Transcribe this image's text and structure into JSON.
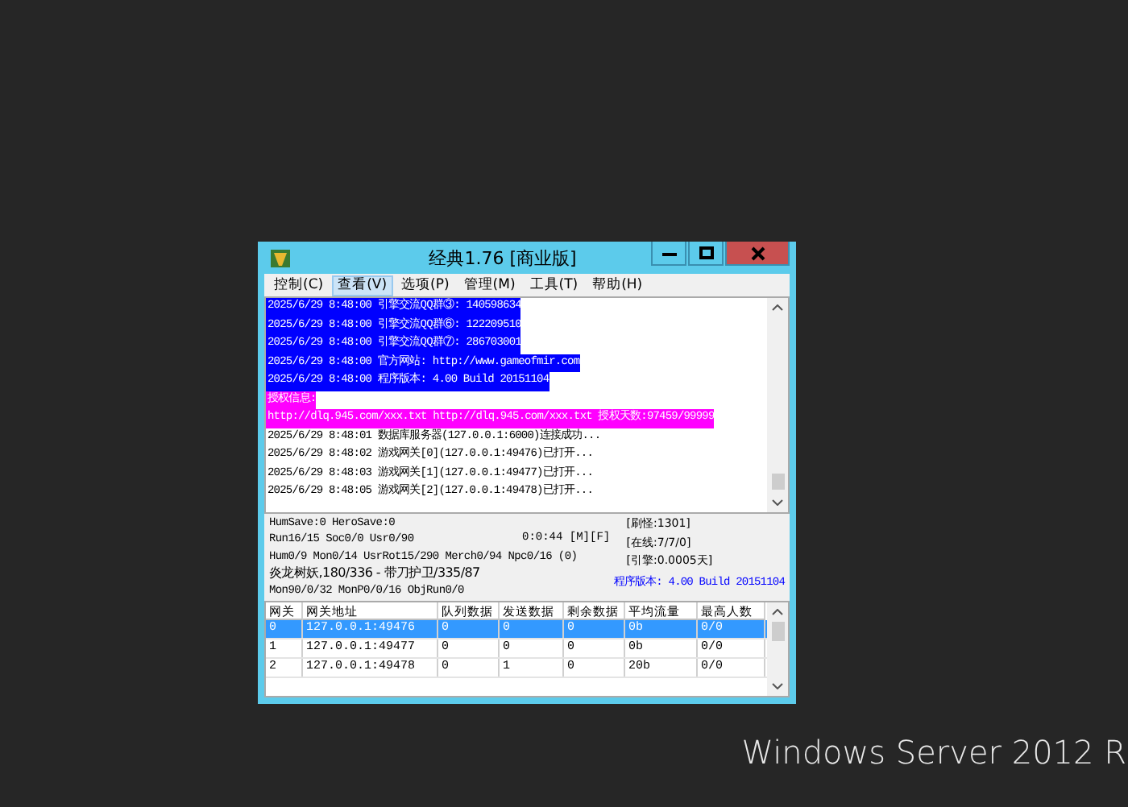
{
  "window": {
    "title": "经典1.76 [商业版]"
  },
  "menu": [
    {
      "label": "控制(C)",
      "selected": false
    },
    {
      "label": "查看(V)",
      "selected": true
    },
    {
      "label": "选项(P)",
      "selected": false
    },
    {
      "label": "管理(M)",
      "selected": false
    },
    {
      "label": "工具(T)",
      "selected": false
    },
    {
      "label": "帮助(H)",
      "selected": false
    }
  ],
  "log": [
    {
      "kind": "selected",
      "text": "2025/6/29 8:48:00 引擎交流QQ群③: 140598634"
    },
    {
      "kind": "selected",
      "text": "2025/6/29 8:48:00 引擎交流QQ群⑥: 122209510"
    },
    {
      "kind": "selected",
      "text": "2025/6/29 8:48:00 引擎交流QQ群⑦: 286703001"
    },
    {
      "kind": "selected",
      "text": "2025/6/29 8:48:00 官方网站: http://www.gameofmir.com"
    },
    {
      "kind": "selected",
      "text": "2025/6/29 8:48:00 程序版本: 4.00 Build 20151104"
    },
    {
      "kind": "highlight",
      "text": "授权信息:"
    },
    {
      "kind": "highlight",
      "text": "http://dlq.945.com/xxx.txt http://dlq.945.com/xxx.txt 授权天数:97459/99999"
    },
    {
      "kind": "normal",
      "text": "2025/6/29 8:48:01 数据库服务器(127.0.0.1:6000)连接成功..."
    },
    {
      "kind": "normal",
      "text": "2025/6/29 8:48:02 游戏网关[0](127.0.0.1:49476)已打开..."
    },
    {
      "kind": "normal",
      "text": "2025/6/29 8:48:03 游戏网关[1](127.0.0.1:49477)已打开..."
    },
    {
      "kind": "normal",
      "text": "2025/6/29 8:48:05 游戏网关[2](127.0.0.1:49478)已打开..."
    }
  ],
  "status": {
    "lines": [
      "HumSave:0 HeroSave:0",
      "Run16/15 Soc0/0 Usr0/90",
      "Hum0/9 Mon0/14 UsrRot15/290 Merch0/94 Npc0/16 (0)",
      "炎龙树妖,180/336 - 带刀护卫/335/87",
      "Mon90/0/32 MonP0/0/16 ObjRun0/0"
    ],
    "timer": "0:0:44 [M][F]",
    "counters": [
      "[刷怪:1301]",
      "[在线:7/7/0]",
      "[引擎:0.0005天]"
    ],
    "version": "程序版本: 4.00 Build 20151104"
  },
  "table": {
    "columns": [
      "网关",
      "网关地址",
      "队列数据",
      "发送数据",
      "剩余数据",
      "平均流量",
      "最高人数"
    ],
    "rows": [
      {
        "selected": true,
        "cells": [
          "0",
          "127.0.0.1:49476",
          "0",
          "0",
          "0",
          "0b",
          "0/0"
        ]
      },
      {
        "selected": false,
        "cells": [
          "1",
          "127.0.0.1:49477",
          "0",
          "0",
          "0",
          "0b",
          "0/0"
        ]
      },
      {
        "selected": false,
        "cells": [
          "2",
          "127.0.0.1:49478",
          "0",
          "1",
          "0",
          "20b",
          "0/0"
        ]
      }
    ]
  },
  "desktop": {
    "branding": "Windows Server 2012 R"
  }
}
